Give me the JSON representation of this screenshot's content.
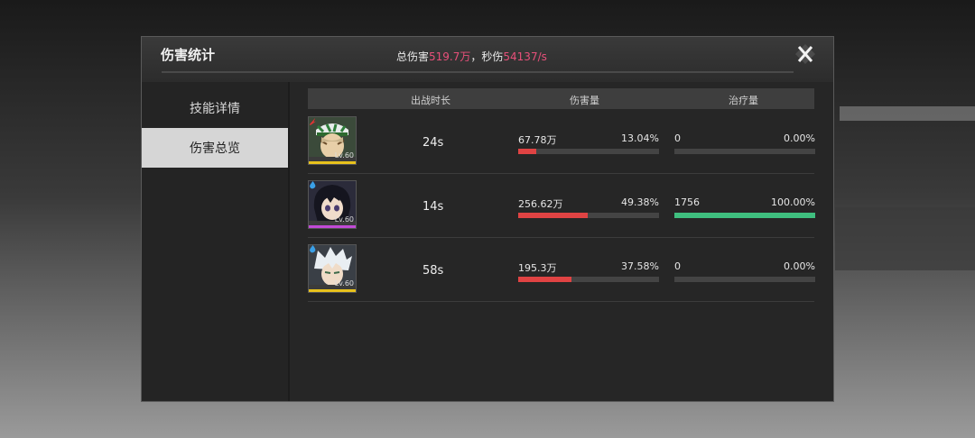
{
  "panel": {
    "title": "伤害统计",
    "summary": {
      "total_label": "总伤害",
      "total_value": "519.7万",
      "sep": "，",
      "dps_label": "秒伤",
      "dps_value": "54137/s"
    }
  },
  "sidebar": {
    "items": [
      {
        "label": "技能详情",
        "active": false
      },
      {
        "label": "伤害总览",
        "active": true
      }
    ]
  },
  "table": {
    "headers": {
      "duration": "出战时长",
      "damage": "伤害量",
      "heal": "治疗量"
    },
    "rows": [
      {
        "level": "Lv.60",
        "element_icon": "fire-element-icon",
        "rarity_color": "#e8c21c",
        "duration": "24s",
        "damage_value": "67.78万",
        "damage_pct": "13.04%",
        "damage_fraction": 0.1304,
        "heal_value": "0",
        "heal_pct": "0.00%",
        "heal_fraction": 0.0
      },
      {
        "level": "Lv.60",
        "element_icon": "water-element-icon",
        "rarity_color": "#c24ad6",
        "duration": "14s",
        "damage_value": "256.62万",
        "damage_pct": "49.38%",
        "damage_fraction": 0.4938,
        "heal_value": "1756",
        "heal_pct": "100.00%",
        "heal_fraction": 1.0
      },
      {
        "level": "Lv.60",
        "element_icon": "water-element-icon",
        "rarity_color": "#e8c21c",
        "duration": "58s",
        "damage_value": "195.3万",
        "damage_pct": "37.58%",
        "damage_fraction": 0.3758,
        "heal_value": "0",
        "heal_pct": "0.00%",
        "heal_fraction": 0.0
      }
    ]
  },
  "colors": {
    "damage_bar": "#e04343",
    "heal_bar": "#3fbf7f",
    "highlight": "#e8507a"
  }
}
